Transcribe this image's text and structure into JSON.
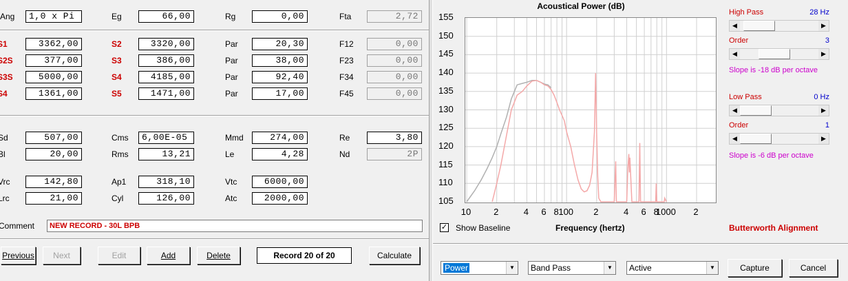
{
  "params": {
    "ang": {
      "label": "Ang",
      "value": "1,0 x Pi"
    },
    "eg": {
      "label": "Eg",
      "value": "66,00"
    },
    "rg": {
      "label": "Rg",
      "value": "0,00"
    },
    "fta": {
      "label": "Fta",
      "value": "2,72"
    },
    "s1": {
      "label": "S1",
      "value": "3362,00"
    },
    "s2": {
      "label": "S2",
      "value": "3320,00"
    },
    "par1": {
      "label": "Par",
      "value": "20,30"
    },
    "f12": {
      "label": "F12",
      "value": "0,00"
    },
    "s2s": {
      "label": "S2S",
      "value": "377,00"
    },
    "s3": {
      "label": "S3",
      "value": "386,00"
    },
    "par2": {
      "label": "Par",
      "value": "38,00"
    },
    "f23": {
      "label": "F23",
      "value": "0,00"
    },
    "s3s": {
      "label": "S3S",
      "value": "5000,00"
    },
    "s4": {
      "label": "S4",
      "value": "4185,00"
    },
    "par3": {
      "label": "Par",
      "value": "92,40"
    },
    "f34": {
      "label": "F34",
      "value": "0,00"
    },
    "s4b": {
      "label": "S4",
      "value": "1361,00"
    },
    "s5": {
      "label": "S5",
      "value": "1471,00"
    },
    "par4": {
      "label": "Par",
      "value": "17,00"
    },
    "f45": {
      "label": "F45",
      "value": "0,00"
    },
    "sd": {
      "label": "Sd",
      "value": "507,00"
    },
    "cms": {
      "label": "Cms",
      "value": "6,00E-05"
    },
    "mmd": {
      "label": "Mmd",
      "value": "274,00"
    },
    "re": {
      "label": "Re",
      "value": "3,80"
    },
    "bl": {
      "label": "Bl",
      "value": "20,00"
    },
    "rms": {
      "label": "Rms",
      "value": "13,21"
    },
    "le": {
      "label": "Le",
      "value": "4,28"
    },
    "nd": {
      "label": "Nd",
      "value": "2P"
    },
    "vrc": {
      "label": "Vrc",
      "value": "142,80"
    },
    "ap1": {
      "label": "Ap1",
      "value": "318,10"
    },
    "vtc": {
      "label": "Vtc",
      "value": "6000,00"
    },
    "lrc": {
      "label": "Lrc",
      "value": "21,00"
    },
    "cyl": {
      "label": "Cyl",
      "value": "126,00"
    },
    "atc": {
      "label": "Atc",
      "value": "2000,00"
    }
  },
  "comment": {
    "label": "Comment",
    "value": "NEW RECORD - 30L BPB"
  },
  "nav": {
    "previous": "Previous",
    "next": "Next",
    "edit": "Edit",
    "add": "Add",
    "delete": "Delete",
    "record": "Record 20 of 20",
    "calculate": "Calculate"
  },
  "chart": {
    "title": "Acoustical Power (dB)",
    "y_ticks": [
      "155",
      "150",
      "145",
      "140",
      "135",
      "130",
      "125",
      "120",
      "115",
      "110",
      "105"
    ],
    "x_ticks": [
      "10",
      "2",
      "4",
      "6",
      "8",
      "100",
      "2",
      "4",
      "6",
      "8",
      "1000",
      "2"
    ],
    "show_baseline_label": "Show Baseline",
    "show_baseline_checked": true,
    "check_glyph": "✓",
    "xlabel": "Frequency (hertz)",
    "alignment": "Butterworth Alignment",
    "baseline_color": "#b0b0b0",
    "response_color": "#f4a8a8"
  },
  "chart_data": {
    "type": "line",
    "title": "Acoustical Power (dB)",
    "xlabel": "Frequency (hertz)",
    "ylabel": "",
    "xscale": "log",
    "xlim": [
      10,
      2000
    ],
    "ylim": [
      105,
      155
    ],
    "grid": true,
    "series": [
      {
        "x": [
          10,
          12,
          14,
          16,
          18,
          20,
          22,
          25,
          28,
          32,
          36,
          40,
          45,
          50,
          55,
          60,
          65,
          70
        ],
        "y": [
          105,
          108,
          111,
          114,
          117,
          120,
          123.5,
          128,
          133,
          136.8,
          137.2,
          137.5,
          138,
          138,
          137.5,
          137,
          136.8,
          136
        ]
      },
      {
        "x": [
          18,
          20,
          22,
          25,
          28,
          32,
          36,
          40,
          45,
          50,
          55,
          60,
          65,
          70,
          75,
          80,
          85,
          90,
          95,
          100,
          110,
          120,
          130,
          140,
          150,
          160,
          170,
          180,
          190,
          195,
          200,
          205,
          210,
          220,
          240,
          260,
          280,
          300,
          310,
          315,
          320,
          330,
          380,
          400,
          410,
          420,
          425,
          430,
          450,
          500,
          530,
          540,
          550,
          600,
          700,
          780,
          790,
          800,
          900,
          950,
          960,
          1000
        ],
        "y": [
          105,
          110,
          115,
          123,
          130,
          134,
          135,
          136.5,
          137.8,
          138,
          137.5,
          136.8,
          136.5,
          135.5,
          134,
          132,
          130,
          128.5,
          127,
          124,
          120,
          115,
          111,
          108.5,
          107.7,
          108,
          109.5,
          113,
          124,
          140,
          124,
          112,
          106,
          105,
          105,
          105,
          105,
          105,
          116,
          105,
          105,
          105,
          105,
          105,
          114,
          118,
          113,
          117,
          105,
          105,
          105,
          121,
          105,
          105,
          105,
          105,
          110,
          105,
          105,
          105,
          106,
          105
        ]
      }
    ]
  },
  "filters": {
    "high_pass": {
      "label": "High Pass",
      "value": "28 Hz",
      "order_label": "Order",
      "order_value": "3",
      "slope": "Slope is -18 dB per octave",
      "freq_pos": 0.08,
      "order_pos": 0.4
    },
    "low_pass": {
      "label": "Low Pass",
      "value": "0 Hz",
      "order_label": "Order",
      "order_value": "1",
      "slope": "Slope is -6 dB per octave",
      "freq_pos": 0.0,
      "order_pos": 0.0
    }
  },
  "controls": {
    "combo1": "Power",
    "combo2": "Band Pass",
    "combo3": "Active",
    "capture": "Capture",
    "cancel": "Cancel"
  }
}
